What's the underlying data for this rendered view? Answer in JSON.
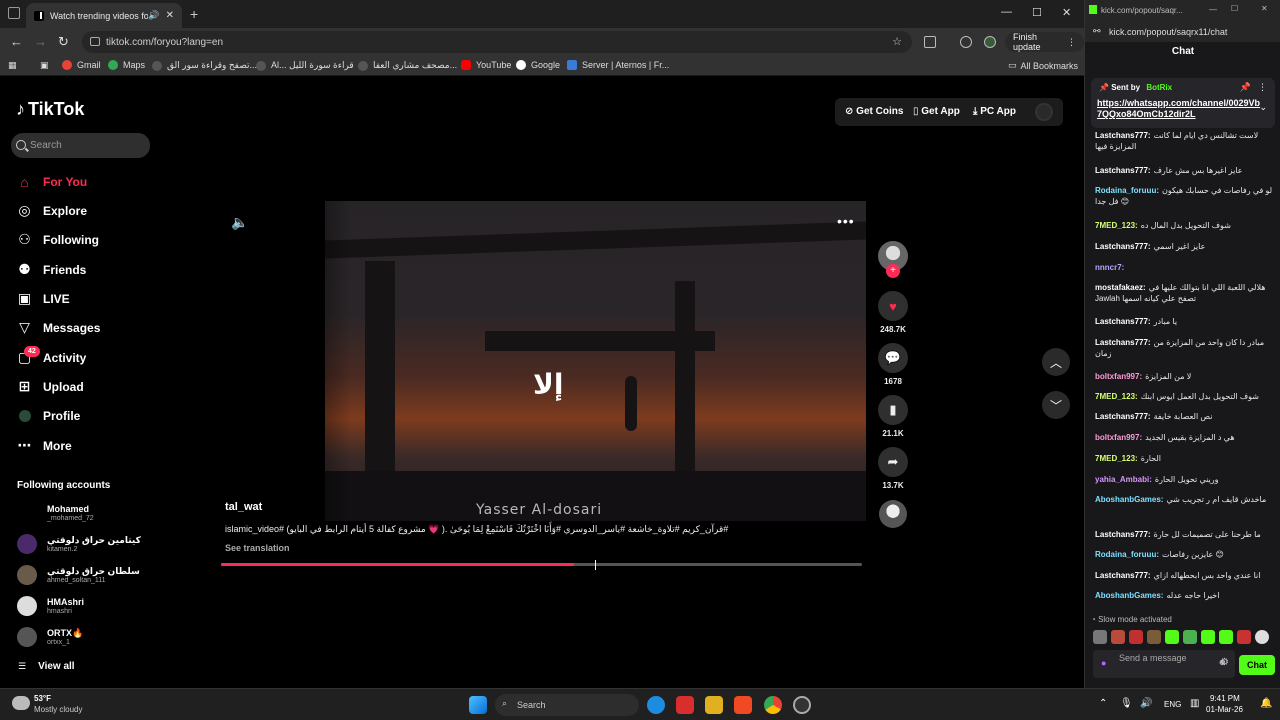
{
  "browser": {
    "tab_title": "Watch trending videos for y",
    "url": "tiktok.com/foryou?lang=en",
    "finish_update": "Finish update",
    "bookmarks": [
      "Gmail",
      "Maps",
      "تصفح وقراءة سور الق...",
      "Al... قراءة سورة الليل",
      "مصحف مشاري العفا...",
      "YouTube",
      "Google",
      "Server | Aternos | Fr..."
    ],
    "all_bookmarks": "All Bookmarks"
  },
  "tiktok": {
    "logo": "TikTok",
    "search_placeholder": "Search",
    "nav": [
      "For You",
      "Explore",
      "Following",
      "Friends",
      "LIVE",
      "Messages",
      "Activity",
      "Upload",
      "Profile",
      "More"
    ],
    "activity_badge": "42",
    "following_accounts_title": "Following accounts",
    "accounts": [
      {
        "name": "Mohamed",
        "handle": "_mohamed_72"
      },
      {
        "name": "كيتامين حراق دلوقتي",
        "handle": "kitamen.2"
      },
      {
        "name": "سلطان حراق دلوقتي",
        "handle": "ahmed_soltan_111"
      },
      {
        "name": "HMAshri",
        "handle": "hmashri"
      },
      {
        "name": "ORTX🔥",
        "handle": "ortxx_1"
      }
    ],
    "view_all": "View all",
    "top_actions": {
      "coins": "Get Coins",
      "app": "Get App",
      "pc": "PC App"
    },
    "video": {
      "overlay_text": "إلا",
      "reciter": "Yasser Al-dosari",
      "author": "tal_wat",
      "caption": "#قرآن_كريم #تلاوة_خاشعة #ياسر_الدوسري #وَأَنَا اخْتَرْتُكَ فَاسْتَمِعْ لِمَا يُوحَىٰ .( 💗 مشروع كفالة 5 أيتام  الرابط في البايو) #islamic_video",
      "see_translation": "See translation",
      "progress_fraction": 0.55,
      "likes": "248.7K",
      "comments": "1678",
      "saves": "21.1K",
      "shares": "13.7K"
    }
  },
  "kick": {
    "window_title": "kick.com/popout/saqr...",
    "url": "kick.com/popout/saqrx11/chat",
    "header": "Chat",
    "pinned_sent_by": "Sent by",
    "pinned_user": "BotRix",
    "pinned_link": "https://whatsapp.com/channel/0029Vb7QQxo84OmCb12dir2L",
    "messages": [
      {
        "user": "Lastchans777:",
        "text": "لاست تشالنس دي ايام لما كانت المزايزة فيها",
        "color": "#ffffff"
      },
      {
        "user": "Lastchans777:",
        "text": "عايز اغيرها بس مش عارف",
        "color": "#ffffff"
      },
      {
        "user": "Rodaina_foruuu:",
        "text": "لو في رفاصات في حسابك هيكون فل جدا 😊",
        "color": "#7ee0ff"
      },
      {
        "user": "7MED_123:",
        "text": "شوف التحويل بدل المال ده",
        "color": "#d7ff73"
      },
      {
        "user": "Lastchans777:",
        "text": "عايز اغير اسمي",
        "color": "#ffffff"
      },
      {
        "user": "nnncr7:",
        "text": "",
        "color": "#b9a6ff"
      },
      {
        "user": "mostafakaez:",
        "text": "هلالي اللعبة اللي انا بتوالك عليها في Jawlah تصفح علي كيانه اسمها",
        "color": "#ffffff"
      },
      {
        "user": "Lastchans777:",
        "text": "يا مبادر",
        "color": "#ffffff"
      },
      {
        "user": "Lastchans777:",
        "text": "مبادر دا كان واحد من المزايزة من زمان",
        "color": "#ffffff"
      },
      {
        "user": "boltxfan997:",
        "text": "لا من المزايزة",
        "color": "#ff9bd5"
      },
      {
        "user": "7MED_123:",
        "text": "شوف التحويل بدل العمل ايوس ابنك",
        "color": "#d7ff73"
      },
      {
        "user": "Lastchans777:",
        "text": "نص العصابة خايفة",
        "color": "#ffffff"
      },
      {
        "user": "boltxfan997:",
        "text": "هي د المزايزة بقيس الجديد",
        "color": "#ff9bd5"
      },
      {
        "user": "7MED_123:",
        "text": "الحارة",
        "color": "#d7ff73"
      },
      {
        "user": "yahia_Ambabi:",
        "text": "وريني تحويل الحارة",
        "color": "#d696ff"
      },
      {
        "user": "AboshanbGames:",
        "text": "ماخدش قايف ام ر تجريب شي",
        "color": "#7ee0ff"
      },
      {
        "user": "Lastchans777:",
        "text": "ما طرحنا على تصميمات لل حارة",
        "color": "#ffffff"
      },
      {
        "user": "Rodaina_foruuu:",
        "text": "عايزين رفاصات 😊",
        "color": "#7ee0ff"
      },
      {
        "user": "Lastchans777:",
        "text": "انا عندي واحد بس ابحطهاله ازاي",
        "color": "#ffffff"
      },
      {
        "user": "AboshanbGames:",
        "text": "اخيرا حاجه عدله",
        "color": "#7ee0ff"
      }
    ],
    "slow_mode": "Slow mode activated",
    "send_placeholder": "Send a message",
    "chat_button": "Chat"
  },
  "taskbar": {
    "weather_temp": "53°F",
    "weather_desc": "Mostly cloudy",
    "search": "Search",
    "lang": "ENG",
    "time": "9:41 PM",
    "date": "01-Mar-26"
  },
  "colors": {
    "tiktok_red": "#fe2c55",
    "kick_green": "#53fc18"
  }
}
